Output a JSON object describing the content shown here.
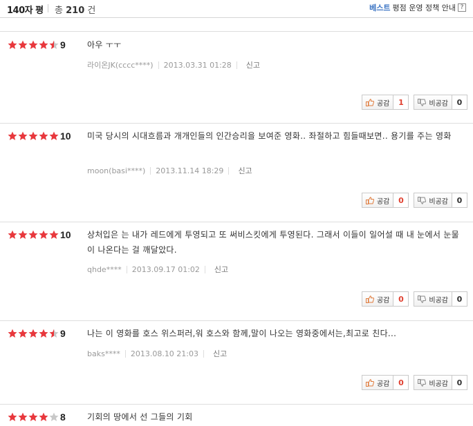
{
  "header": {
    "title": "140자 평",
    "total_prefix": "총",
    "total_count": "210",
    "total_suffix": "건",
    "best_label": "베스트",
    "policy_label": "평점 운영 정책 안내",
    "help_glyph": "?"
  },
  "colors": {
    "star_on": "#e8383d",
    "star_off": "#c8c8c8",
    "accent": "#3d75c4"
  },
  "buttons": {
    "like_label": "공감",
    "dislike_label": "비공감",
    "report_label": "신고"
  },
  "reviews": [
    {
      "stars": 4.5,
      "score": "9",
      "text": "아우 ㅜㅜ",
      "author": "라이온JK(cccc****)",
      "date": "2013.03.31 01:28",
      "likes": "1",
      "dislikes": "0"
    },
    {
      "stars": 5,
      "score": "10",
      "text": "미국 당시의 시대흐름과 개개인들의 인간승리을 보여준 영화.. 좌절하고 힘들때보면.. 용기를 주는 영화",
      "author": "moon(basi****)",
      "date": "2013.11.14 18:29",
      "likes": "0",
      "dislikes": "0"
    },
    {
      "stars": 5,
      "score": "10",
      "text": "상처입은 는 내가 레드에게 투영되고 또 써비스킷에게 투영된다. 그래서 이들이 일어설 때 내 눈에서 눈물이 나온다는 걸 깨달았다.",
      "author": "qhde****",
      "date": "2013.09.17 01:02",
      "likes": "0",
      "dislikes": "0"
    },
    {
      "stars": 4.5,
      "score": "9",
      "text": "나는 이 영화를 호스 위스퍼러,워 호스와 함께,말이 나오는 영화중에서는,최고로 친다...",
      "author": "baks****",
      "date": "2013.08.10 21:03",
      "likes": "0",
      "dislikes": "0"
    },
    {
      "stars": 4,
      "score": "8",
      "text": "기회의 땅에서 선 그들의 기회"
    }
  ]
}
